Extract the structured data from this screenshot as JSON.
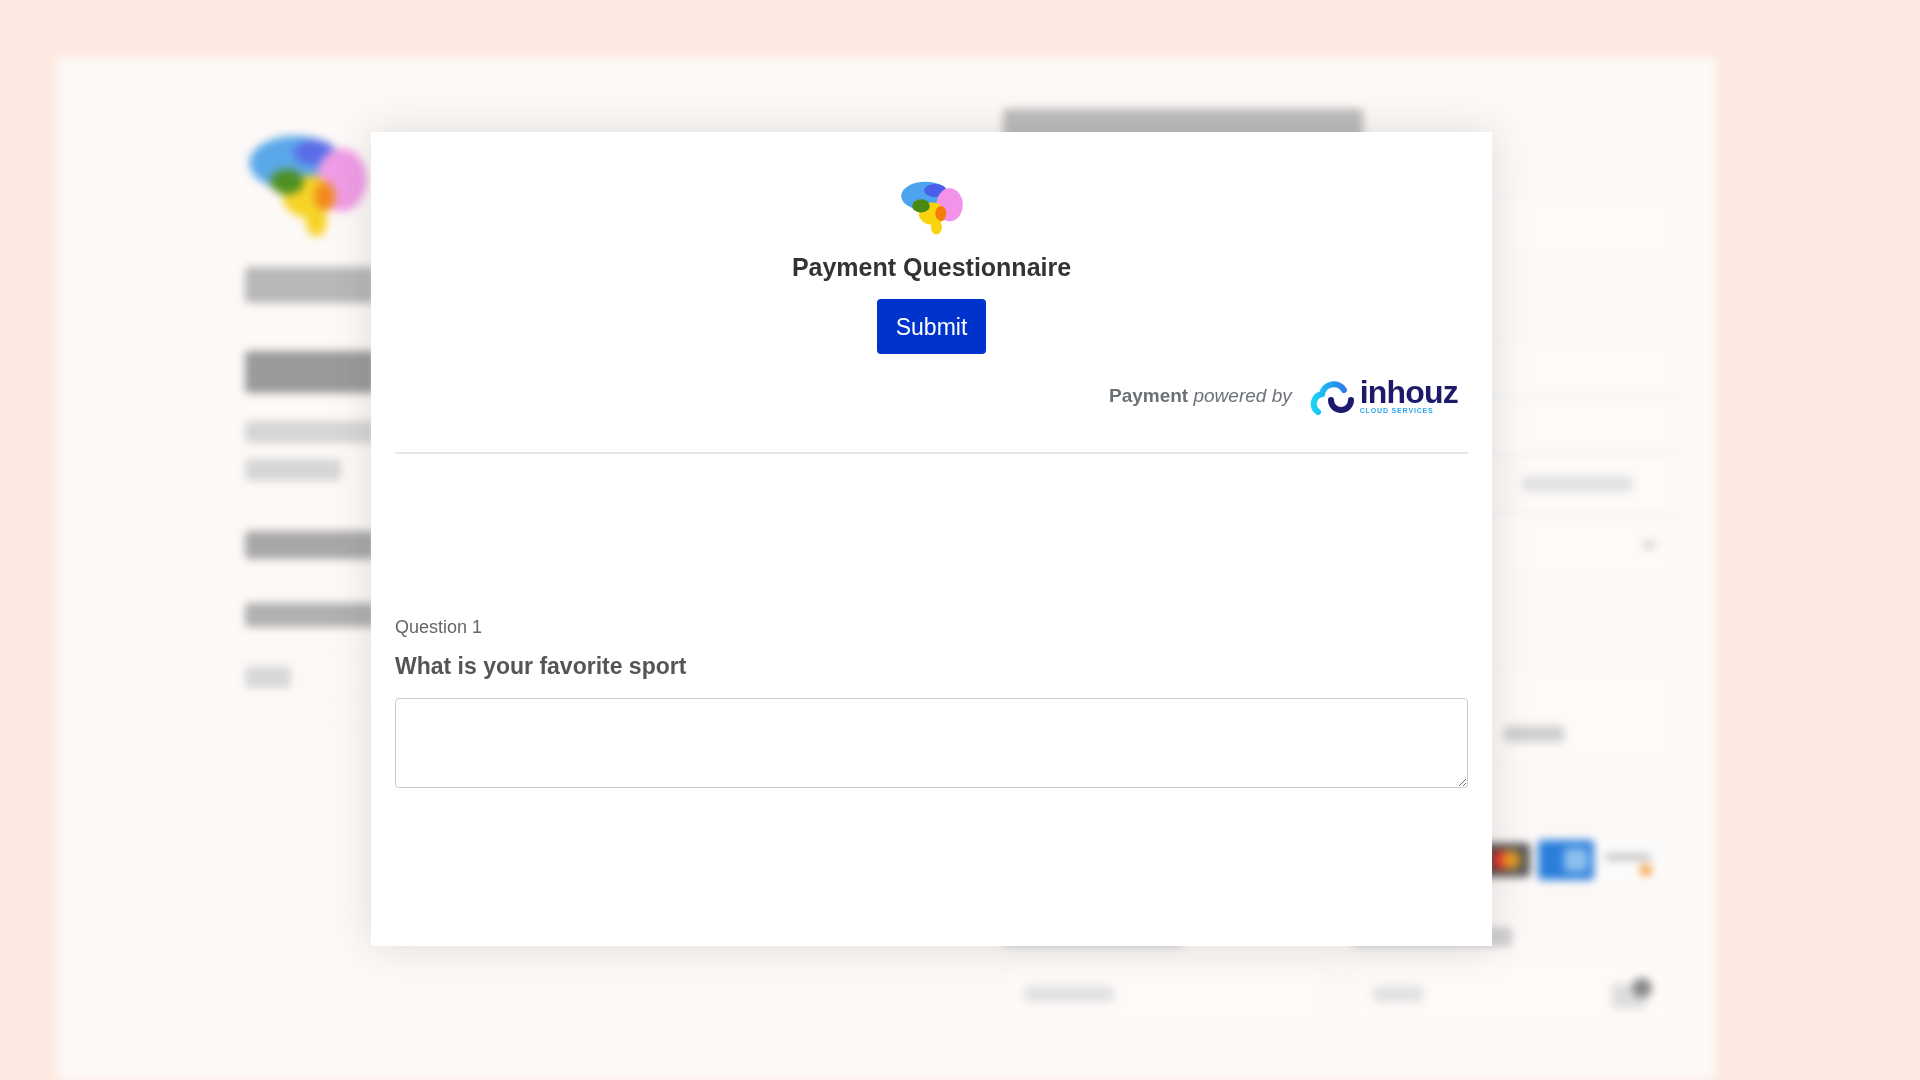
{
  "dialog": {
    "title": "Payment Questionnaire",
    "submit": "Submit",
    "powered": "**Payment** *powered by*",
    "brand": "inhouz",
    "brand_tagline": "CLOUD SERVICES",
    "questions": [
      {
        "number": "Question 1",
        "text": "What is your favorite sport"
      }
    ]
  }
}
